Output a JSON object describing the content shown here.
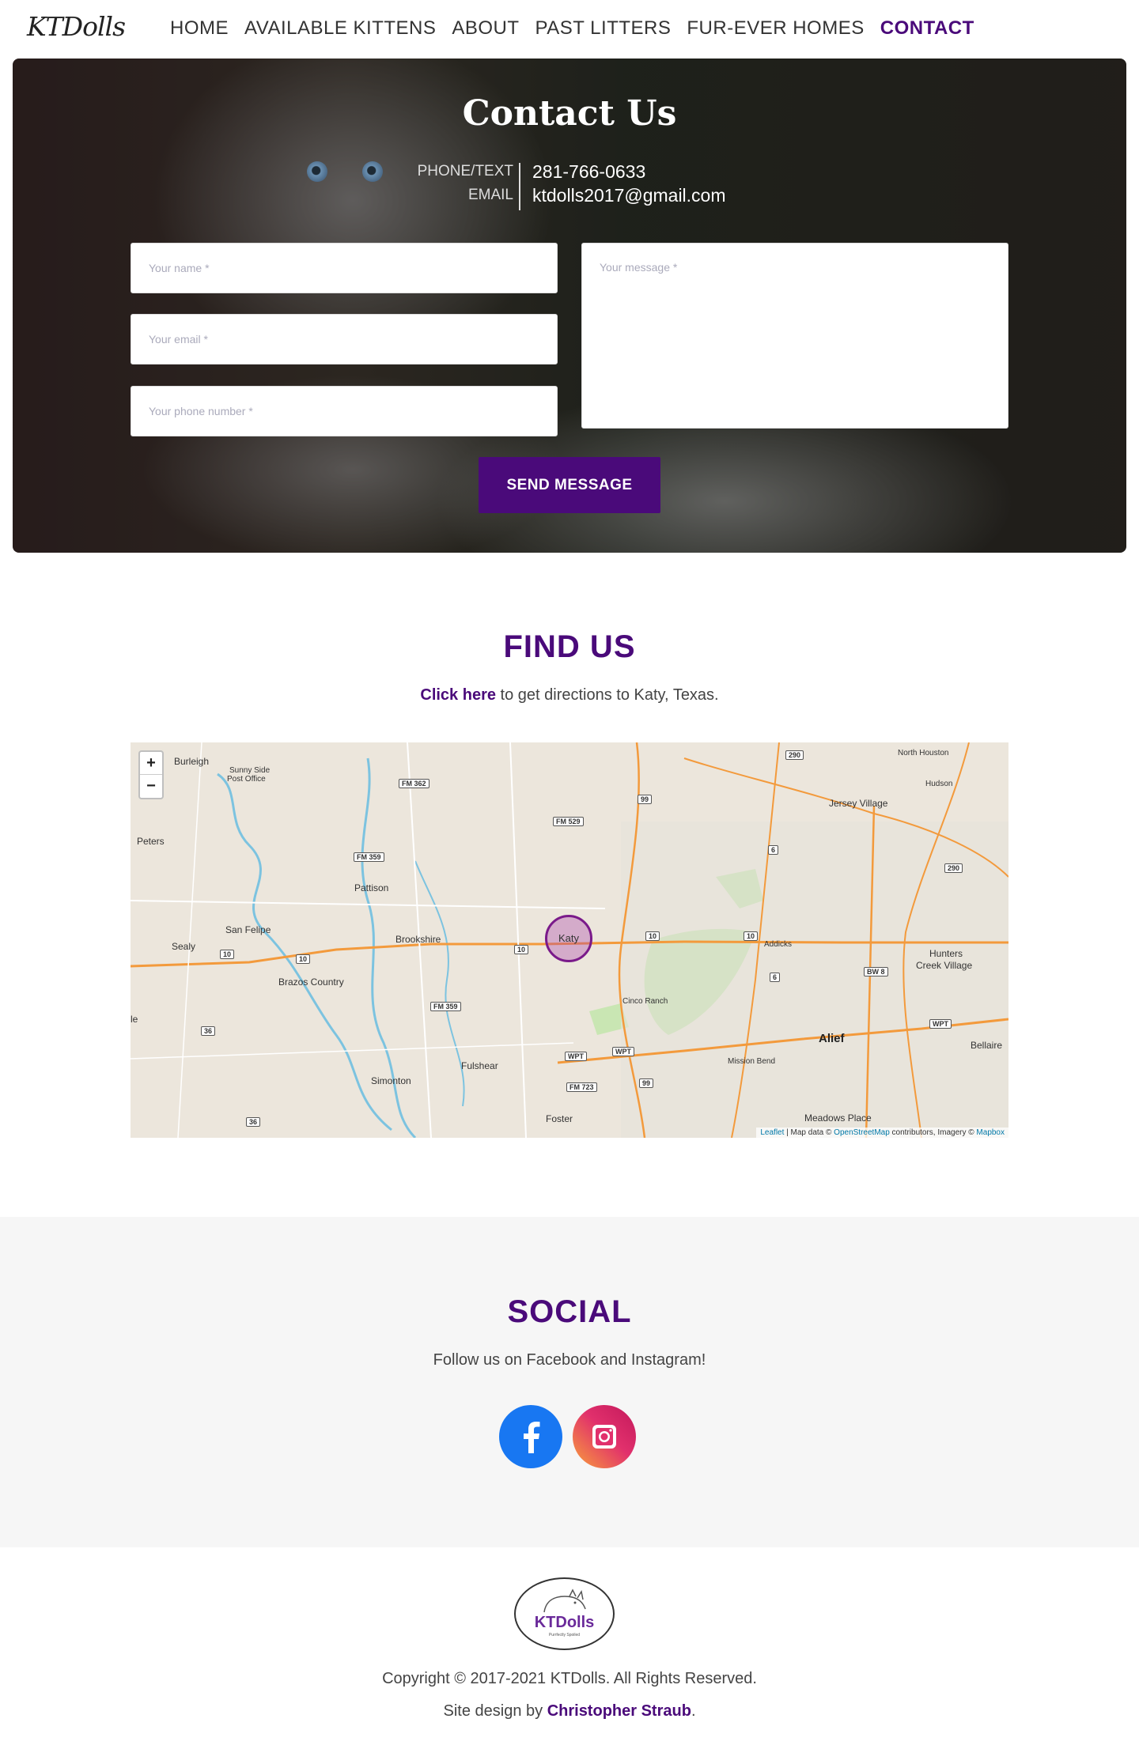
{
  "nav": {
    "logo": "KTDolls",
    "items": [
      {
        "label": "HOME"
      },
      {
        "label": "AVAILABLE KITTENS"
      },
      {
        "label": "ABOUT"
      },
      {
        "label": "PAST LITTERS"
      },
      {
        "label": "FUR-EVER HOMES"
      },
      {
        "label": "CONTACT",
        "active": true
      }
    ]
  },
  "hero": {
    "title": "Contact Us",
    "phone_label": "PHONE/TEXT",
    "email_label": "EMAIL",
    "phone": "281-766-0633",
    "email": "ktdolls2017@gmail.com",
    "form": {
      "name_placeholder": "Your name *",
      "email_placeholder": "Your email *",
      "phone_placeholder": "Your phone number *",
      "message_placeholder": "Your message *",
      "submit_label": "SEND MESSAGE"
    }
  },
  "find_us": {
    "title": "FIND US",
    "link_text": "Click here",
    "text_after": " to get directions to Katy, Texas.",
    "map": {
      "zoom_in": "+",
      "zoom_out": "−",
      "marker_label": "Katy",
      "places": {
        "burleigh": "Burleigh",
        "sunny_side_1": "Sunny Side",
        "sunny_side_2": "Post Office",
        "peters": "Peters",
        "pattison": "Pattison",
        "san_felipe": "San Felipe",
        "sealy": "Sealy",
        "brookshire": "Brookshire",
        "brazos_country": "Brazos Country",
        "fulshear": "Fulshear",
        "simonton": "Simonton",
        "foster": "Foster",
        "cinco_ranch": "Cinco Ranch",
        "mission_bend": "Mission Bend",
        "alief": "Alief",
        "meadows_place": "Meadows Place",
        "bellaire": "Bellaire",
        "hunters_creek_1": "Hunters",
        "hunters_creek_2": "Creek Village",
        "jersey_village": "Jersey Village",
        "north_houston": "North Houston",
        "hudson": "Hudson",
        "addicks": "Addicks",
        "le": "le"
      },
      "roads": {
        "fm362": "FM 362",
        "fm529": "FM 529",
        "fm359a": "FM 359",
        "fm359b": "FM 359",
        "fm723": "FM 723",
        "wpt1": "WPT",
        "wpt2": "WPT",
        "wpt3": "WPT",
        "bw8": "BW 8",
        "r290a": "290",
        "r290b": "290",
        "r99a": "99",
        "r99b": "99",
        "r6a": "6",
        "r6b": "6",
        "r36a": "36",
        "r36b": "36",
        "i10a": "10",
        "i10b": "10",
        "i10c": "10",
        "i10d": "10",
        "i10e": "10"
      },
      "attribution": {
        "leaflet": "Leaflet",
        "sep1": " | Map data © ",
        "osm": "OpenStreetMap",
        "sep2": " contributors, Imagery © ",
        "mapbox": "Mapbox"
      }
    }
  },
  "social": {
    "title": "SOCIAL",
    "text": "Follow us on Facebook and Instagram!"
  },
  "footer": {
    "logo_text": "KTDolls",
    "logo_sub": "Purrfectly Spoiled",
    "copyright": "Copyright © 2017-2021 KTDolls. All Rights Reserved.",
    "credit_prefix": "Site design by ",
    "credit_name": "Christopher Straub",
    "credit_suffix": "."
  },
  "colors": {
    "brand": "#4a0a7a",
    "facebook": "#1877f2",
    "social_bg": "#f6f6f6"
  }
}
